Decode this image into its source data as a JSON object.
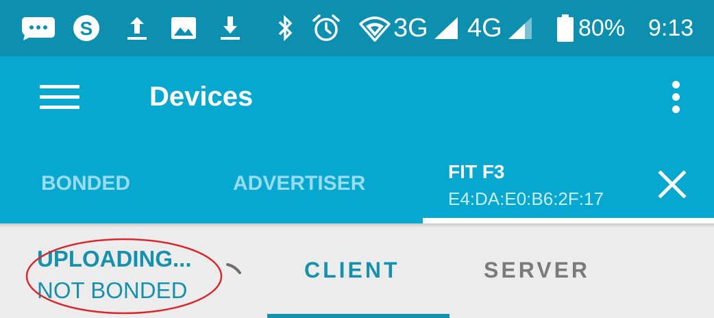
{
  "status_bar": {
    "icons": [
      "more-chat-icon",
      "skype-icon",
      "upload-icon",
      "image-icon",
      "download-icon",
      "bluetooth-icon",
      "alarm-icon",
      "wifi-icon",
      "signal-icon",
      "signal-icon",
      "battery-icon"
    ],
    "network_1": "3G",
    "network_2": "4G",
    "battery": "80%",
    "time": "9:13"
  },
  "app_bar": {
    "title": "Devices",
    "menu_icon": "hamburger-menu-icon",
    "overflow_icon": "more-vert-icon"
  },
  "tabs": {
    "items": [
      {
        "label": "BONDED"
      },
      {
        "label": "ADVERTISER"
      }
    ],
    "active": {
      "title": "FIT F3",
      "subtitle": "E4:DA:E0:B6:2F:17"
    },
    "close_icon": "close-icon"
  },
  "device": {
    "status": "UPLOADING...",
    "bond_state": "NOT BONDED"
  },
  "subtabs": {
    "client": "CLIENT",
    "server": "SERVER",
    "selected": "CLIENT"
  },
  "colors": {
    "status_bar": "#0d8fb0",
    "app_bar": "#07a8cf",
    "accent": "#1691ad",
    "annotation": "#d9262b",
    "inactive_tab": "#9adcef"
  }
}
